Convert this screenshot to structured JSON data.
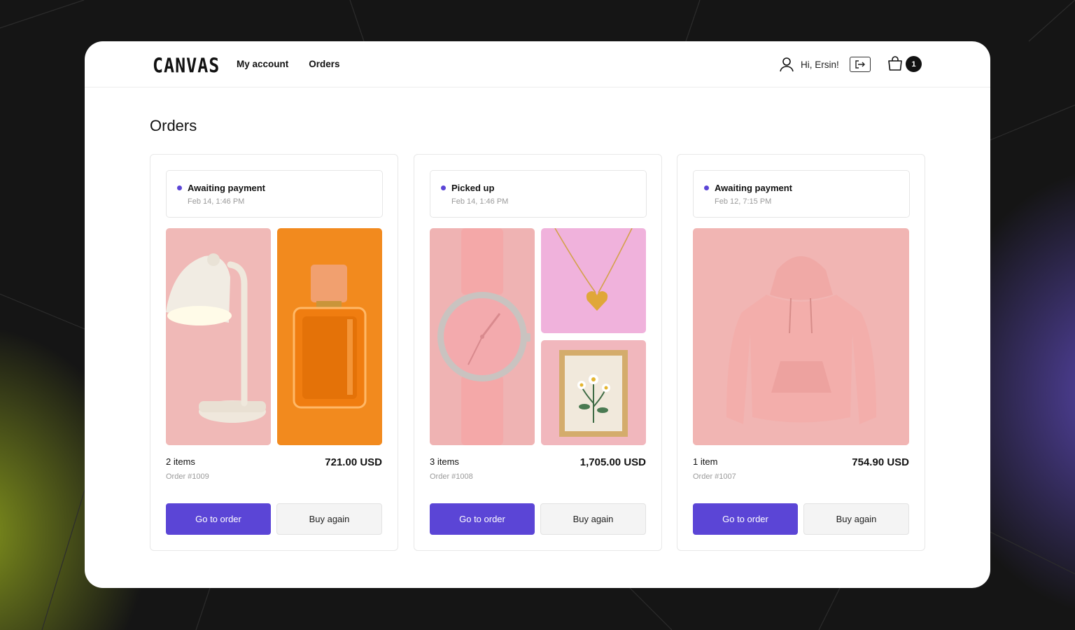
{
  "app": {
    "logo": "CANVAS"
  },
  "nav": {
    "items": [
      {
        "label": "My account"
      },
      {
        "label": "Orders"
      }
    ]
  },
  "header": {
    "greeting": "Hi, Ersin!",
    "cart_count": "1"
  },
  "page": {
    "title": "Orders"
  },
  "colors": {
    "accent": "#5b45d6",
    "status_dot": "#5b45d6"
  },
  "orders": [
    {
      "status": "Awaiting payment",
      "date": "Feb 14, 1:46 PM",
      "items_count": "2 items",
      "order_number": "Order #1009",
      "total": "721.00 USD",
      "images": [
        "desk-lamp",
        "perfume-bottle"
      ],
      "primary_action": "Go to order",
      "secondary_action": "Buy again"
    },
    {
      "status": "Picked up",
      "date": "Feb 14, 1:46 PM",
      "items_count": "3 items",
      "order_number": "Order #1008",
      "total": "1,705.00 USD",
      "images": [
        "wristwatch",
        "heart-necklace",
        "framed-flowers"
      ],
      "primary_action": "Go to order",
      "secondary_action": "Buy again"
    },
    {
      "status": "Awaiting payment",
      "date": "Feb 12, 7:15 PM",
      "items_count": "1 item",
      "order_number": "Order #1007",
      "total": "754.90 USD",
      "images": [
        "pink-hoodie"
      ],
      "primary_action": "Go to order",
      "secondary_action": "Buy again"
    }
  ]
}
